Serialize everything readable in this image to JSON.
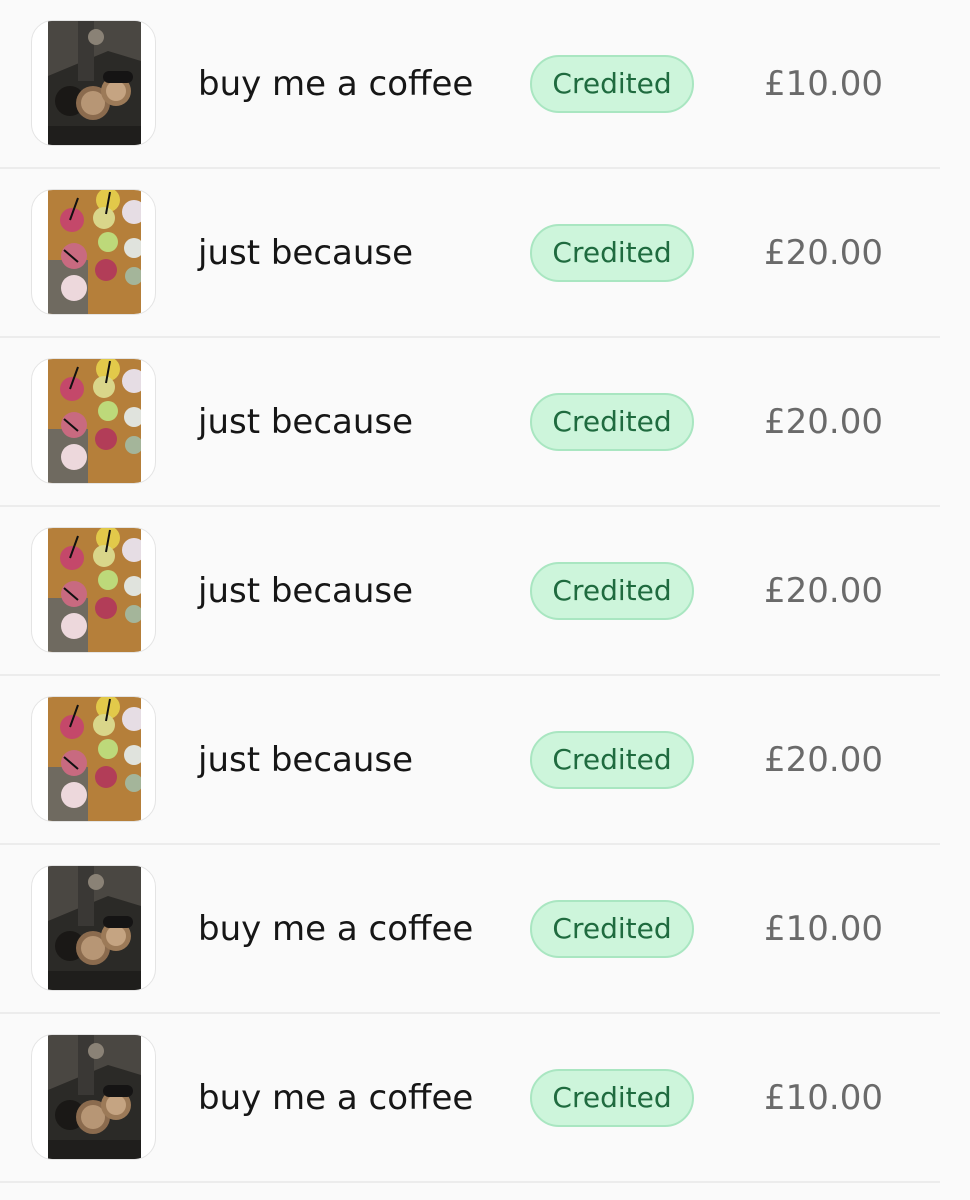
{
  "transactions": [
    {
      "title": "buy me a coffee",
      "status": "Credited",
      "amount": "£10.00",
      "thumbnail": "coffee-photo"
    },
    {
      "title": "just because",
      "status": "Credited",
      "amount": "£20.00",
      "thumbnail": "drinks-photo"
    },
    {
      "title": "just because",
      "status": "Credited",
      "amount": "£20.00",
      "thumbnail": "drinks-photo"
    },
    {
      "title": "just because",
      "status": "Credited",
      "amount": "£20.00",
      "thumbnail": "drinks-photo"
    },
    {
      "title": "just because",
      "status": "Credited",
      "amount": "£20.00",
      "thumbnail": "drinks-photo"
    },
    {
      "title": "buy me a coffee",
      "status": "Credited",
      "amount": "£10.00",
      "thumbnail": "coffee-photo"
    },
    {
      "title": "buy me a coffee",
      "status": "Credited",
      "amount": "£10.00",
      "thumbnail": "coffee-photo"
    }
  ],
  "colors": {
    "badge_bg": "#cdf5db",
    "badge_text": "#1f6b3f",
    "amount_text": "#6a6a6a"
  }
}
